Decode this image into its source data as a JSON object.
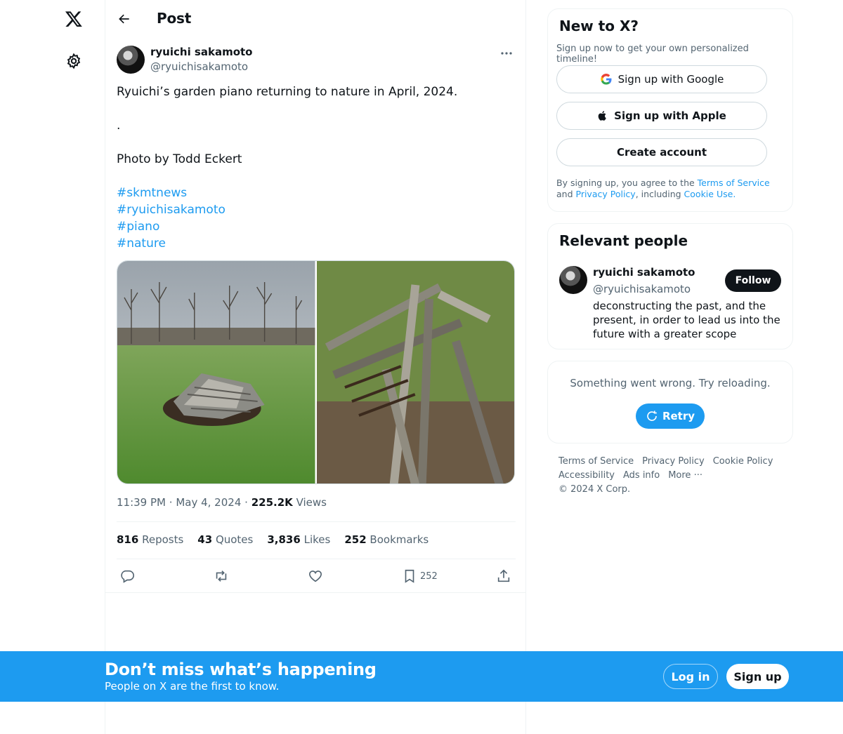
{
  "header": {
    "title": "Post"
  },
  "post": {
    "author_name": "ryuichi sakamoto",
    "author_handle": "@ryuichisakamoto",
    "text_lines": [
      "Ryuichi’s garden piano returning to nature in April, 2024.",
      ".",
      "Photo by Todd Eckert"
    ],
    "hashtags": [
      "#skmtnews",
      "#ryuichisakamoto",
      "#piano",
      "#nature"
    ],
    "time": "11:39 PM",
    "sep": "·",
    "date": "May 4, 2024",
    "views_count": "225.2K",
    "views_label": "Views",
    "reposts_count": "816",
    "reposts_label": "Reposts",
    "quotes_count": "43",
    "quotes_label": "Quotes",
    "likes_count": "3,836",
    "likes_label": "Likes",
    "bookmarks_count": "252",
    "bookmarks_label": "Bookmarks",
    "bookmark_action_count": "252"
  },
  "signup_card": {
    "title": "New to X?",
    "subtitle": "Sign up now to get your own personalized timeline!",
    "google_label": "Sign up with Google",
    "apple_label": "Sign up with Apple",
    "create_label": "Create account",
    "legal_prefix": "By signing up, you agree to the ",
    "terms_link": "Terms of Service",
    "legal_and": " and ",
    "privacy_link": "Privacy Policy",
    "legal_including": ", including ",
    "cookie_link": "Cookie Use",
    "legal_end": "."
  },
  "relevant": {
    "title": "Relevant people",
    "name": "ryuichi sakamoto",
    "handle": "@ryuichisakamoto",
    "bio": "deconstructing the past, and the present, in order to lead us into the future with a greater scope",
    "follow_label": "Follow"
  },
  "error_card": {
    "message": "Something went wrong. Try reloading.",
    "retry_label": "Retry"
  },
  "footer": {
    "links": [
      "Terms of Service",
      "Privacy Policy",
      "Cookie Policy",
      "Accessibility",
      "Ads info",
      "More ···",
      "© 2024 X Corp."
    ]
  },
  "banner": {
    "title": "Don’t miss what’s happening",
    "subtitle": "People on X are the first to know.",
    "login_label": "Log in",
    "signup_label": "Sign up"
  },
  "colors": {
    "accent": "#1d9bf0",
    "text": "#0f1419",
    "muted": "#536471",
    "border": "#eff3f4"
  },
  "icons": [
    "x-logo-icon",
    "gear-icon",
    "back-arrow-icon",
    "more-icon",
    "reply-icon",
    "repost-icon",
    "like-icon",
    "bookmark-icon",
    "share-icon",
    "google-icon",
    "apple-icon",
    "retry-icon"
  ]
}
